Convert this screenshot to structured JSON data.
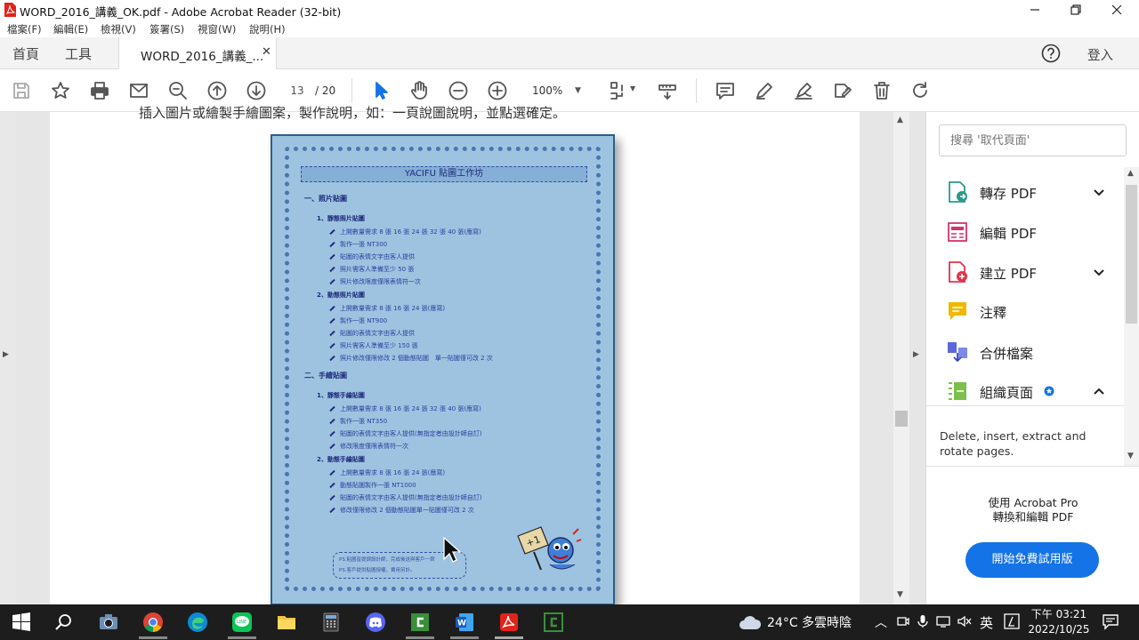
{
  "window": {
    "title": "WORD_2016_講義_OK.pdf - Adobe Acrobat Reader (32-bit)"
  },
  "menu": [
    "檔案(F)",
    "編輯(E)",
    "檢視(V)",
    "簽署(S)",
    "視窗(W)",
    "說明(H)"
  ],
  "tabs": {
    "home": "首頁",
    "tools": "工具",
    "doc": "WORD_2016_講義_...",
    "login": "登入"
  },
  "toolbar": {
    "page_current": "13",
    "page_total": "/ 20",
    "zoom": "100%"
  },
  "document": {
    "top_cut_text": "插入圖片或繪製手繪圖案，製作說明，如：一頁說圖說明，並點選確定。",
    "banner": "YACIFU 貼圖工作坊",
    "sec1": "一、照片貼圖",
    "sec1_1": "1、靜態照片貼圖",
    "sec1_1_items": [
      "上開數量需求 8 張 16 張 24 張 32 張 40 張(應寫)",
      "製作一張 NT300",
      "貼圖的表情文字由客人提供",
      "照片需客人準備至少 50 張",
      "照片修改限度僅限表情符一次"
    ],
    "sec1_2": "2、動態照片貼圖",
    "sec1_2_items": [
      "上開數量需求 8 張 16 張 24 張(應寫)",
      "製作一張 NT900",
      "貼圖的表情文字由客人提供",
      "照片需客人準備至少 150 張",
      "照片修改僅限修改 2 個動態貼圖　單一貼圖僅可改 2 次"
    ],
    "sec2": "二、手繪貼圖",
    "sec2_1": "1、靜態手繪貼圖",
    "sec2_1_items": [
      "上開數量需求 8 張 16 張 24 張 32 張 40 張(應寫)",
      "製作一張 NT350",
      "貼圖的表情文字由客人提供(無指定者由設計師自訂)",
      "修改限度僅限表情符一次"
    ],
    "sec2_2": "2、動態手繪貼圖",
    "sec2_2_items": [
      "上開數量需求 8 張 16 張 24 張(應寫)",
      "動態貼圖製作一張 NT1000",
      "貼圖的表情文字由客人提供(無指定者由設計師自訂)",
      "修改僅限修改 2 個動態貼圖單一貼圖僅可改 2 次"
    ],
    "note1": "PS.貼圖皆提調設計師，完成後送與客戶一齊",
    "note2": "PS.客戶提供貼圖授權，費用另計。"
  },
  "rightpane": {
    "search_placeholder": "搜尋 '取代頁面'",
    "tools": [
      {
        "label": "轉存 PDF"
      },
      {
        "label": "編輯 PDF"
      },
      {
        "label": "建立 PDF"
      },
      {
        "label": "注釋"
      },
      {
        "label": "合併檔案"
      },
      {
        "label": "組織頁面"
      }
    ],
    "organize_desc_1": "Delete, insert, extract and",
    "organize_desc_2": "rotate pages.",
    "promo_line1": "使用 Acrobat Pro",
    "promo_line2": "轉換和編輯 PDF",
    "trial_button": "開始免費試用版"
  },
  "taskbar": {
    "weather": "24°C  多雲時陰",
    "ime": "英",
    "time": "下午 03:21",
    "date": "2022/10/25"
  },
  "colors": {
    "accent": "#1473e6",
    "page_bg": "#9ec3e0",
    "acrobat_red": "#e2231a"
  }
}
